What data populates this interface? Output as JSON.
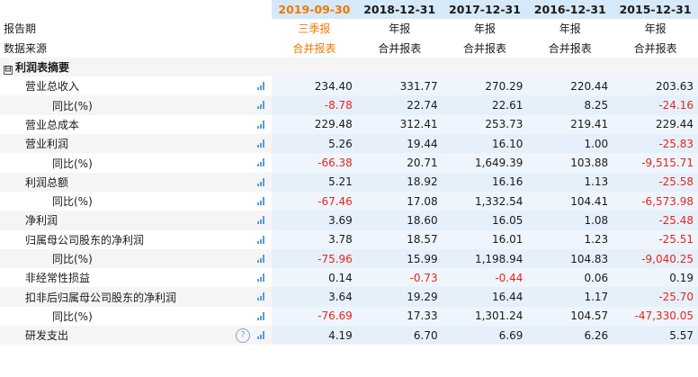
{
  "columns": [
    "2019-09-30",
    "2018-12-31",
    "2017-12-31",
    "2016-12-31",
    "2015-12-31"
  ],
  "report_period": {
    "label": "报告期",
    "values": [
      "三季报",
      "年报",
      "年报",
      "年报",
      "年报"
    ]
  },
  "data_source": {
    "label": "数据来源",
    "values": [
      "合并报表",
      "合并报表",
      "合并报表",
      "合并报表",
      "合并报表"
    ]
  },
  "section": {
    "toggle": "⊟",
    "label": "利润表摘要"
  },
  "rows": [
    {
      "label": "营业总收入",
      "level": 1,
      "values": [
        "234.40",
        "331.77",
        "270.29",
        "220.44",
        "203.63"
      ]
    },
    {
      "label": "同比(%)",
      "level": 2,
      "values": [
        "-8.78",
        "22.74",
        "22.61",
        "8.25",
        "-24.16"
      ]
    },
    {
      "label": "营业总成本",
      "level": 1,
      "values": [
        "229.48",
        "312.41",
        "253.73",
        "219.41",
        "229.44"
      ]
    },
    {
      "label": "营业利润",
      "level": 1,
      "values": [
        "5.26",
        "19.44",
        "16.10",
        "1.00",
        "-25.83"
      ]
    },
    {
      "label": "同比(%)",
      "level": 2,
      "values": [
        "-66.38",
        "20.71",
        "1,649.39",
        "103.88",
        "-9,515.71"
      ]
    },
    {
      "label": "利润总额",
      "level": 1,
      "values": [
        "5.21",
        "18.92",
        "16.16",
        "1.13",
        "-25.58"
      ]
    },
    {
      "label": "同比(%)",
      "level": 2,
      "values": [
        "-67.46",
        "17.08",
        "1,332.54",
        "104.41",
        "-6,573.98"
      ]
    },
    {
      "label": "净利润",
      "level": 1,
      "values": [
        "3.69",
        "18.60",
        "16.05",
        "1.08",
        "-25.48"
      ]
    },
    {
      "label": "归属母公司股东的净利润",
      "level": 1,
      "values": [
        "3.78",
        "18.57",
        "16.01",
        "1.23",
        "-25.51"
      ]
    },
    {
      "label": "同比(%)",
      "level": 2,
      "values": [
        "-75.96",
        "15.99",
        "1,198.94",
        "104.83",
        "-9,040.25"
      ]
    },
    {
      "label": "非经常性损益",
      "level": 1,
      "values": [
        "0.14",
        "-0.73",
        "-0.44",
        "0.06",
        "0.19"
      ]
    },
    {
      "label": "扣非后归属母公司股东的净利润",
      "level": 1,
      "values": [
        "3.64",
        "19.29",
        "16.44",
        "1.17",
        "-25.70"
      ]
    },
    {
      "label": "同比(%)",
      "level": 2,
      "values": [
        "-76.69",
        "17.33",
        "1,301.24",
        "104.57",
        "-47,330.05"
      ]
    },
    {
      "label": "研发支出",
      "level": 1,
      "help": "?",
      "values": [
        "4.19",
        "6.70",
        "6.69",
        "6.26",
        "5.57"
      ]
    }
  ],
  "icons": {
    "chart": "bar-chart-icon",
    "help": "help-icon"
  },
  "colors": {
    "accent": "#f07800",
    "negative": "#e8251a",
    "header_bg": "#d6e9f8",
    "chart_icon": "#5b9bd5"
  }
}
